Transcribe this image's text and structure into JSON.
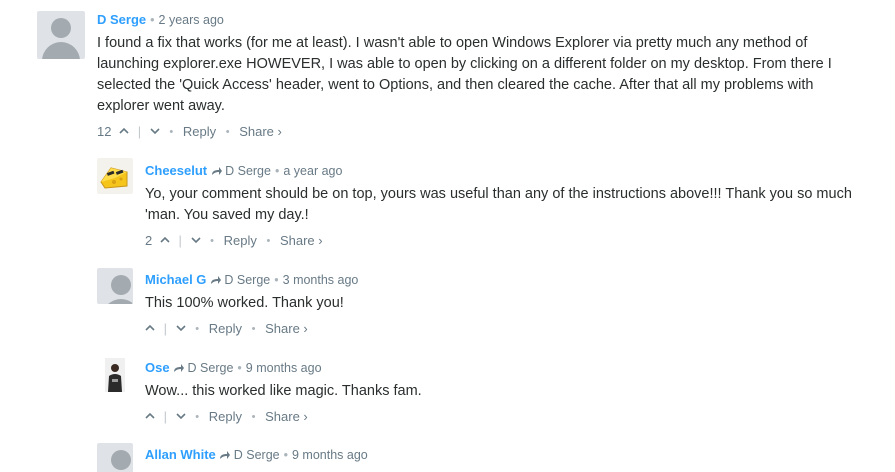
{
  "comments": [
    {
      "author": "D Serge",
      "reply_to": "",
      "time": "2 years ago",
      "text": "I found a fix that works (for me at least). I wasn't able to open Windows Explorer via pretty much any method of launching explorer.exe HOWEVER, I was able to open by clicking on a different folder on my desktop. From there I selected the 'Quick Access' header, went to Options, and then cleared the cache. After that all my problems with explorer went away.",
      "upvotes": "12",
      "reply_label": "Reply",
      "share_label": "Share ›",
      "avatar": "default-avatar"
    },
    {
      "author": "Cheeselut",
      "reply_to": "D Serge",
      "time": "a year ago",
      "text": "Yo, your comment should be on top, yours was useful than any of the instructions above!!! Thank you so much 'man. You saved my day.!",
      "upvotes": "2",
      "reply_label": "Reply",
      "share_label": "Share ›",
      "avatar": "cheese-avatar"
    },
    {
      "author": "Michael G",
      "reply_to": "D Serge",
      "time": "3 months ago",
      "text": "This 100% worked. Thank you!",
      "upvotes": "",
      "reply_label": "Reply",
      "share_label": "Share ›",
      "avatar": "default-avatar"
    },
    {
      "author": "Ose",
      "reply_to": "D Serge",
      "time": "9 months ago",
      "text": "Wow... this worked like magic. Thanks fam.",
      "upvotes": "",
      "reply_label": "Reply",
      "share_label": "Share ›",
      "avatar": "photo-avatar"
    },
    {
      "author": "Allan White",
      "reply_to": "D Serge",
      "time": "9 months ago",
      "text": "",
      "upvotes": "",
      "reply_label": "",
      "share_label": "",
      "avatar": "default-avatar"
    }
  ],
  "icons": {
    "upvote": "chevron-up-icon",
    "downvote": "chevron-down-icon",
    "reply_arrow": "reply-arrow-icon"
  },
  "colors": {
    "author": "#2e9fff",
    "meta": "#687a86",
    "text": "#2a2e2e",
    "avatar_bg": "#dfe3e8",
    "avatar_fg": "#a3aab0"
  }
}
